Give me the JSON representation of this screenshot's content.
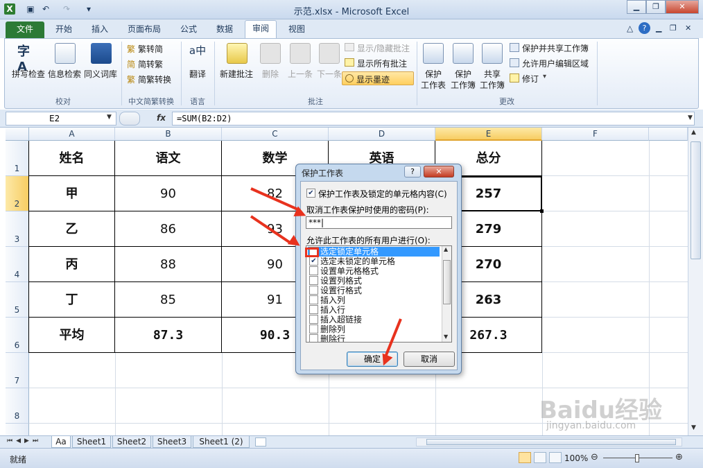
{
  "window": {
    "title": "示范.xlsx - Microsoft Excel"
  },
  "ribbon_tabs": [
    "文件",
    "开始",
    "插入",
    "页面布局",
    "公式",
    "数据",
    "审阅",
    "视图"
  ],
  "ribbon": {
    "proof": {
      "spell": "拼写检查",
      "research": "信息检索",
      "thesaurus": "同义词库",
      "label": "校对"
    },
    "chinese": {
      "to_simplified": "繁转简",
      "to_traditional": "简转繁",
      "convert": "简繁转换",
      "label": "中文简繁转换"
    },
    "language": {
      "translate": "翻译",
      "label": "语言"
    },
    "comments": {
      "new": "新建批注",
      "delete": "删除",
      "prev": "上一条",
      "next": "下一条",
      "show_hide": "显示/隐藏批注",
      "show_all": "显示所有批注",
      "show_ink": "显示墨迹",
      "label": "批注"
    },
    "changes": {
      "protect_sheet_1": "保护",
      "protect_sheet_2": "工作表",
      "protect_book_1": "保护",
      "protect_book_2": "工作簿",
      "share_1": "共享",
      "share_2": "工作簿",
      "protect_share": "保护并共享工作簿",
      "allow_edit": "允许用户编辑区域",
      "track": "修订",
      "label": "更改"
    }
  },
  "formula": {
    "namebox": "E2",
    "fx": "fx",
    "value": "=SUM(B2:D2)"
  },
  "columns": [
    "A",
    "B",
    "C",
    "D",
    "E",
    "F"
  ],
  "rows": [
    "1",
    "2",
    "3",
    "4",
    "5",
    "6",
    "7",
    "8"
  ],
  "table": {
    "headers": [
      "姓名",
      "语文",
      "数学",
      "英语",
      "总分"
    ],
    "rows": [
      [
        "甲",
        "90",
        "82",
        "",
        "257"
      ],
      [
        "乙",
        "86",
        "93",
        "",
        "279"
      ],
      [
        "丙",
        "88",
        "90",
        "",
        "270"
      ],
      [
        "丁",
        "85",
        "91",
        "",
        "263"
      ],
      [
        "平均",
        "87.3",
        "90.3",
        "",
        "267.3"
      ]
    ]
  },
  "sheets": [
    "Aa",
    "Sheet1",
    "Sheet2",
    "Sheet3",
    "Sheet1 (2)"
  ],
  "status": {
    "ready": "就绪",
    "zoom": "100%"
  },
  "dialog": {
    "title": "保护工作表",
    "help": "?",
    "close": "✕",
    "protect_check_label": "保护工作表及锁定的单元格内容(C)",
    "password_label": "取消工作表保护时使用的密码(P):",
    "password_value": "***|",
    "allow_label": "允许此工作表的所有用户进行(O):",
    "options": [
      {
        "label": "选定锁定单元格",
        "checked": false,
        "selected": true
      },
      {
        "label": "选定未锁定的单元格",
        "checked": true,
        "selected": false
      },
      {
        "label": "设置单元格格式",
        "checked": false,
        "selected": false
      },
      {
        "label": "设置列格式",
        "checked": false,
        "selected": false
      },
      {
        "label": "设置行格式",
        "checked": false,
        "selected": false
      },
      {
        "label": "插入列",
        "checked": false,
        "selected": false
      },
      {
        "label": "插入行",
        "checked": false,
        "selected": false
      },
      {
        "label": "插入超链接",
        "checked": false,
        "selected": false
      },
      {
        "label": "删除列",
        "checked": false,
        "selected": false
      },
      {
        "label": "删除行",
        "checked": false,
        "selected": false
      }
    ],
    "ok": "确定",
    "cancel": "取消"
  },
  "watermark": {
    "brand": "Baidu经验",
    "url": "jingyan.baidu.com"
  },
  "colors": {
    "file_tab": "#2c7a35",
    "selection": "#3399ff",
    "arrow": "#e8321e",
    "highlight_box": "#e8321e"
  }
}
